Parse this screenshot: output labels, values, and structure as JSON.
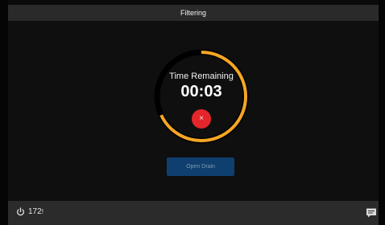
{
  "header": {
    "title": "Filtering"
  },
  "timer": {
    "label": "Time Remaining",
    "value": "00:03",
    "progress": 0.68,
    "ring_color": "#f5a623",
    "track_color": "#000000"
  },
  "actions": {
    "cancel_glyph": "×",
    "cancel_icon": "close-icon",
    "drain_label": "Open Drain"
  },
  "footer": {
    "power_icon": "power-icon",
    "power_value": "172",
    "power_suffix": "!",
    "chat_icon": "chat-icon"
  }
}
